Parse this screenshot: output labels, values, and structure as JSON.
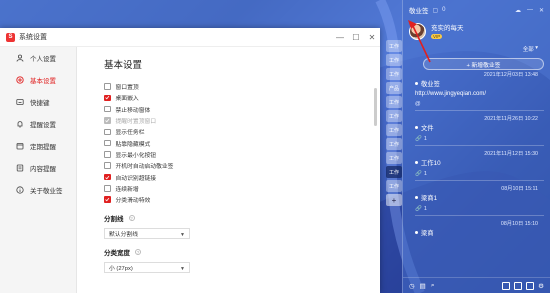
{
  "window": {
    "title": "系统设置",
    "logo_letter": "S",
    "controls": {
      "minimize": "—",
      "maximize": "☐",
      "close": "✕"
    }
  },
  "sidebar": {
    "items": [
      {
        "label": "个人设置",
        "icon": "person-icon",
        "active": false
      },
      {
        "label": "基本设置",
        "icon": "settings-circle-icon",
        "active": true
      },
      {
        "label": "快捷键",
        "icon": "keyboard-icon",
        "active": false
      },
      {
        "label": "提醒设置",
        "icon": "bell-icon",
        "active": false
      },
      {
        "label": "定期提醒",
        "icon": "calendar-icon",
        "active": false
      },
      {
        "label": "内容提醒",
        "icon": "content-reminder-icon",
        "active": false
      },
      {
        "label": "关于敬业签",
        "icon": "info-icon",
        "active": false
      }
    ]
  },
  "main": {
    "heading": "基本设置",
    "options": [
      {
        "label": "窗口置顶",
        "checked": false,
        "disabled": false
      },
      {
        "label": "桌面嵌入",
        "checked": true,
        "disabled": false
      },
      {
        "label": "禁止移动窗体",
        "checked": false,
        "disabled": false
      },
      {
        "label": "提醒时置顶窗口",
        "checked": true,
        "disabled": true
      },
      {
        "label": "显示任务栏",
        "checked": false,
        "disabled": false
      },
      {
        "label": "贴靠隐藏模式",
        "checked": false,
        "disabled": false
      },
      {
        "label": "显示最小化按钮",
        "checked": false,
        "disabled": false
      },
      {
        "label": "开机时自动启动敬业签",
        "checked": false,
        "disabled": false
      },
      {
        "label": "自动识别超链接",
        "checked": true,
        "disabled": false
      },
      {
        "label": "连续新增",
        "checked": false,
        "disabled": false
      },
      {
        "label": "分类滑动特效",
        "checked": true,
        "disabled": false
      }
    ],
    "divider_section": {
      "label": "分割线",
      "value": "默认分割线"
    },
    "category_height": {
      "label": "分类宽度",
      "value": "小 (27px)"
    }
  },
  "panel": {
    "app_name": "敬业签",
    "notif_count": "0",
    "user": {
      "name": "充实的每天",
      "badge": "VIP"
    },
    "filter_label": "全部",
    "new_button": "+ 新增敬业签",
    "notes": [
      {
        "date": "2021年12月03日 13:48",
        "title": "敬业签",
        "body": "http://www.jingyeqian.com/",
        "meta_icon": "@",
        "meta_count": ""
      },
      {
        "date": "2021年11月26日 10:22",
        "title": "文件",
        "body": "",
        "meta_icon": "🔗",
        "meta_count": "1"
      },
      {
        "date": "2021年11月12日 15:30",
        "title": "工作10",
        "body": "",
        "meta_icon": "🔗",
        "meta_count": "1"
      },
      {
        "date": "08月10日 15:11",
        "title": "梁商1",
        "body": "",
        "meta_icon": "🔗",
        "meta_count": "1"
      },
      {
        "date": "08月10日 15:10",
        "title": "梁商",
        "body": "",
        "meta_icon": "",
        "meta_count": ""
      }
    ],
    "strip_tabs": [
      "工作",
      "工作",
      "工作",
      "产品",
      "工作",
      "工作",
      "工作",
      "工作",
      "工作",
      "工作",
      "工作"
    ]
  },
  "colors": {
    "accent": "#e02020",
    "panel_bg": "#466ec8"
  }
}
